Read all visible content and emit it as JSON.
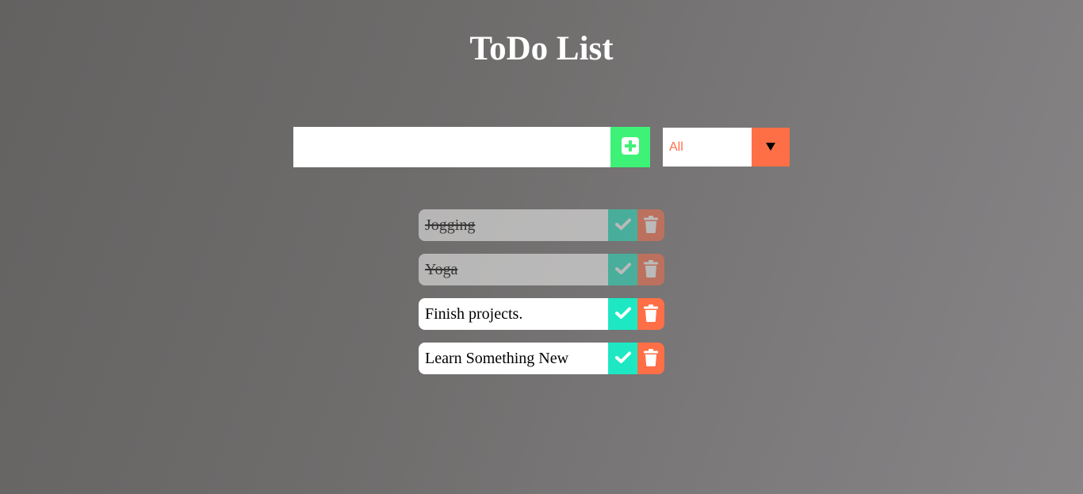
{
  "header": {
    "title": "ToDo List"
  },
  "form": {
    "input_value": "",
    "add_icon": "plus-square-icon",
    "filter_selected": "All",
    "filter_arrow_icon": "triangle-down-icon"
  },
  "colors": {
    "add_button": "#3ef277",
    "complete_button": "#1ee8c4",
    "delete_button": "#ff6f47",
    "filter_text": "#ff6f47"
  },
  "todos": [
    {
      "text": "Jogging",
      "completed": true
    },
    {
      "text": "Yoga",
      "completed": true
    },
    {
      "text": "Finish projects.",
      "completed": false
    },
    {
      "text": "Learn Something New",
      "completed": false
    }
  ],
  "icons": {
    "complete": "check-icon",
    "delete": "trash-icon"
  }
}
